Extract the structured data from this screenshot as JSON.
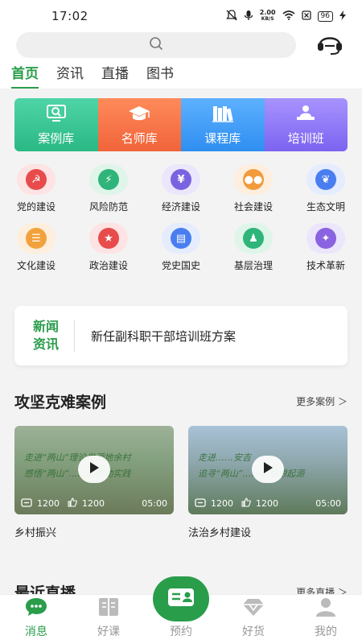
{
  "status_bar": {
    "time": "17:02",
    "net_speed_value": "2.00",
    "net_speed_unit": "KB/S",
    "battery": "96"
  },
  "tabs": [
    {
      "label": "首页",
      "active": true
    },
    {
      "label": "资讯",
      "active": false
    },
    {
      "label": "直播",
      "active": false
    },
    {
      "label": "图书",
      "active": false
    }
  ],
  "banner": [
    {
      "label": "案例库",
      "icon": "magnifier-screen-icon"
    },
    {
      "label": "名师库",
      "icon": "graduation-cap-icon"
    },
    {
      "label": "课程库",
      "icon": "books-icon"
    },
    {
      "label": "培训班",
      "icon": "lecturer-icon"
    }
  ],
  "categories": [
    {
      "label": "党的建设",
      "icon": "party-emblem-icon",
      "bg": "#fde3e3",
      "fg": "#e84b4b"
    },
    {
      "label": "风险防范",
      "icon": "shield-bolt-icon",
      "bg": "#dff5ea",
      "fg": "#2fb57a"
    },
    {
      "label": "经济建设",
      "icon": "money-bag-icon",
      "bg": "#ebe6fb",
      "fg": "#7a63e0"
    },
    {
      "label": "社会建设",
      "icon": "people-icon",
      "bg": "#fdeedd",
      "fg": "#f29a3c"
    },
    {
      "label": "生态文明",
      "icon": "leaf-icon",
      "bg": "#e4ecfd",
      "fg": "#4a7ef0"
    },
    {
      "label": "文化建设",
      "icon": "books-stack-icon",
      "bg": "#fdeedd",
      "fg": "#f2a23c"
    },
    {
      "label": "政治建设",
      "icon": "star-flag-icon",
      "bg": "#fde3e3",
      "fg": "#e84b4b"
    },
    {
      "label": "党史国史",
      "icon": "open-book-icon",
      "bg": "#e4ecfd",
      "fg": "#4a7ef0"
    },
    {
      "label": "基层治理",
      "icon": "person-badge-icon",
      "bg": "#dff5ea",
      "fg": "#2fb57a"
    },
    {
      "label": "技术革新",
      "icon": "lightbulb-icon",
      "bg": "#ebe6fb",
      "fg": "#8a63e0"
    }
  ],
  "news": {
    "tag_line1": "新闻",
    "tag_line2": "资讯",
    "headline": "新任副科职干部培训班方案"
  },
  "cases_section": {
    "title": "攻坚克难案例",
    "more": "更多案例 ＞"
  },
  "videos": [
    {
      "title": "乡村振兴",
      "views": "1200",
      "likes": "1200",
      "duration": "05:00",
      "caption_line1": "走进“两山”理论发源地余村",
      "caption_line2": "感悟“两山”……的生动实践"
    },
    {
      "title": "法治乡村建设",
      "views": "1200",
      "likes": "1200",
      "duration": "05:00",
      "caption_line1": "走进……安吉",
      "caption_line2": "追寻“两山”……的思想起源"
    }
  ],
  "live_section": {
    "title": "最近直播",
    "more": "更多直播 ＞"
  },
  "bottom_nav": [
    {
      "label": "消息",
      "icon": "chat-bubble-icon",
      "active": true
    },
    {
      "label": "好课",
      "icon": "book-icon",
      "active": false
    },
    {
      "label": "预约",
      "icon": "id-card-icon",
      "active": false
    },
    {
      "label": "好货",
      "icon": "diamond-icon",
      "active": false
    },
    {
      "label": "我的",
      "icon": "user-icon",
      "active": false
    }
  ],
  "colors": {
    "brand_green": "#2a9d4b"
  }
}
